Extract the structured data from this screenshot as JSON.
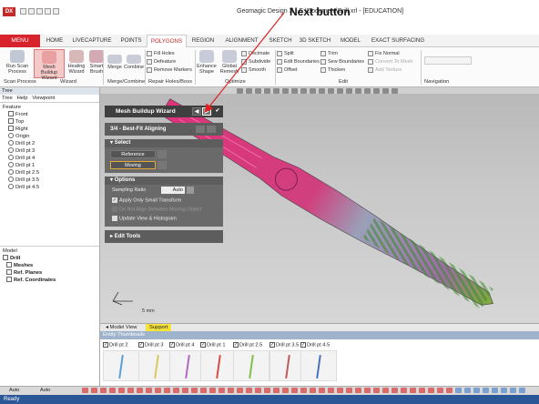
{
  "window": {
    "title": "Geomagic Design X - E:\\Document\\Drill.xrl - [EDUCATION]",
    "logo": "DX"
  },
  "annotation": {
    "text": "Next button"
  },
  "menu": {
    "menu_label": "MENU",
    "tabs": [
      "HOME",
      "LIVECAPTURE",
      "POINTS",
      "POLYGONS",
      "REGION",
      "ALIGNMENT",
      "SKETCH",
      "3D SKETCH",
      "MODEL",
      "EXACT SURFACING"
    ],
    "active": "POLYGONS"
  },
  "ribbon": {
    "run_scan": "Run Scan Process",
    "mesh_buildup": "Mesh Buildup Wizard",
    "healing": "Healing Wizard",
    "smart_brush": "Smart Brush",
    "merge": "Merge",
    "combine": "Combine",
    "fill_holes": "Fill Holes",
    "defeature": "Defeature",
    "remove_markers": "Remove Markers",
    "enhance": "Enhance Shape",
    "global_remesh": "Global Remesh",
    "decimate": "Decimate",
    "subdivide": "Subdivide",
    "smooth": "Smooth",
    "split": "Split",
    "edit_boundaries": "Edit Boundaries",
    "offset": "Offset",
    "trim": "Trim",
    "sew_boundaries": "Sew Boundaries",
    "thicken": "Thicken",
    "fix_normal": "Fix Normal",
    "convert_to_mesh": "Convert To Mesh",
    "add_texture": "Add Texture",
    "groups": [
      "Scan Process",
      "Wizard",
      "Merge/Combine",
      "Repair Holes/Boss",
      "Optimize",
      "Edit",
      "Navigation"
    ]
  },
  "left_panel": {
    "tree_title": "Tree",
    "tabs": [
      "Tree",
      "Help",
      "Viewpoint"
    ],
    "feature_label": "Feature",
    "planes": [
      "Front",
      "Top",
      "Right"
    ],
    "origin": "Origin",
    "drill_points": [
      "Drill pt 2",
      "Drill pt 3",
      "Drill pt 4",
      "Drill pt 1",
      "Drill pt 2.5",
      "Drill pt 3.5",
      "Drill pt 4.5"
    ],
    "model_title": "Model",
    "model_items": [
      "Drill",
      "Meshes",
      "Ref. Planes",
      "Ref. Coordinates"
    ]
  },
  "wizard": {
    "title": "Mesh Buildup Wizard",
    "step": "3/4 - Best-Fit Aligning",
    "select_label": "Select",
    "reference_label": "Reference",
    "moving_label": "Moving",
    "options_label": "Options",
    "sampling_label": "Sampling Ratio",
    "sampling_value": "Auto",
    "opt1": "Apply Only Small Transform",
    "opt2": "Do Not Align Between Moving Object",
    "opt3": "Update View & Histogram",
    "edit_tools": "Edit Tools"
  },
  "viewport": {
    "scale_label": "5 mm",
    "drill_colors": [
      "#e0327a",
      "#9aa0b8",
      "#7fae3a"
    ]
  },
  "bottom_tabs": [
    "Model View",
    "Support"
  ],
  "thumbs": {
    "title": "Entity Thumbnails",
    "items": [
      {
        "label": "Drill pt 2",
        "color": "#5aa0d8"
      },
      {
        "label": "Drill pt 3",
        "color": "#d8c95a"
      },
      {
        "label": "Drill pt 4",
        "color": "#b06ac0"
      },
      {
        "label": "Drill pt 1",
        "color": "#d84a4a"
      },
      {
        "label": "Drill pt 2.5",
        "color": "#7fc04a"
      },
      {
        "label": "Drill pt 3.5",
        "color": "#c05a5a"
      },
      {
        "label": "Drill pt 4.5",
        "color": "#4a70c0"
      }
    ]
  },
  "bottom": {
    "auto1": "Auto",
    "auto2": "Auto"
  },
  "status": {
    "text": "Ready"
  }
}
